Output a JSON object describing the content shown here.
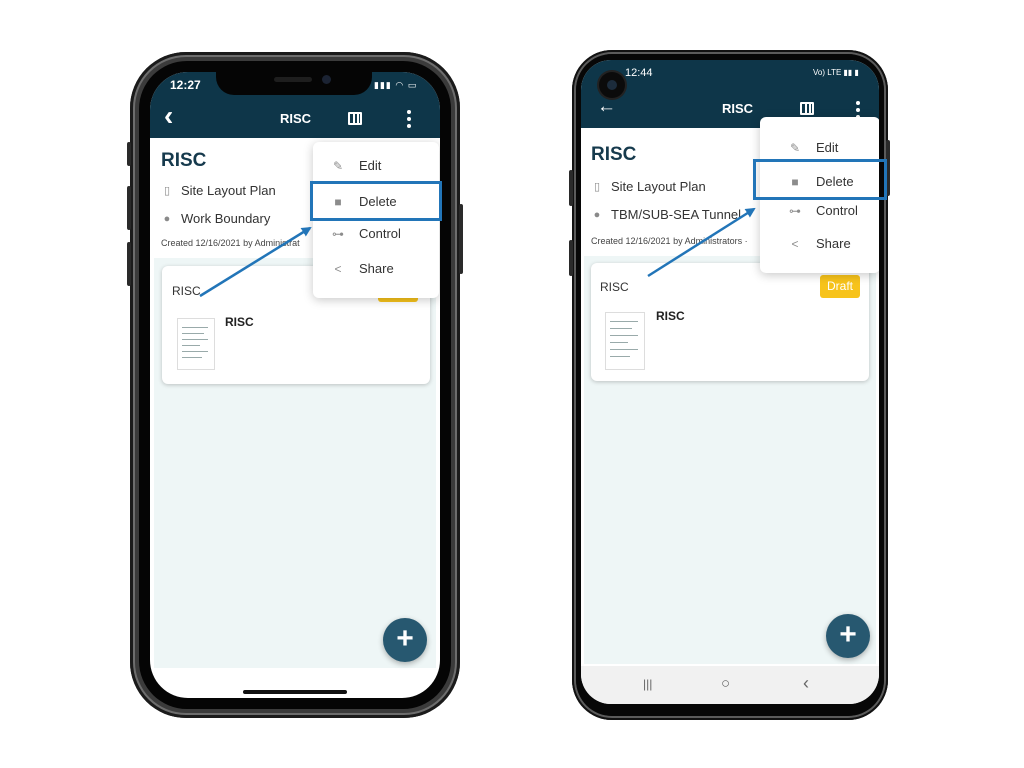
{
  "iphone": {
    "status_time": "12:27",
    "status_icons": "▮▮▮ ◠ ▭",
    "header": {
      "back_glyph": "‹",
      "title": "RISC"
    },
    "doc": {
      "title": "RISC",
      "plan": "Site Layout Plan",
      "location": "Work Boundary",
      "created": "Created 12/16/2021 by Administrat"
    },
    "card": {
      "title": "RISC",
      "doc_name": "RISC"
    },
    "menu": [
      {
        "label": "Edit",
        "icon": "pencil-icon"
      },
      {
        "label": "Delete",
        "icon": "trash-icon"
      },
      {
        "label": "Control",
        "icon": "key-icon"
      },
      {
        "label": "Share",
        "icon": "share-icon"
      }
    ],
    "fab_label": "+"
  },
  "android": {
    "status_time": "12:44",
    "status_icons": "Vo) LTE ▮▮ ▮",
    "header": {
      "back_glyph": "←",
      "title": "RISC"
    },
    "doc": {
      "title": "RISC",
      "plan": "Site Layout Plan",
      "location": "TBM/SUB-SEA Tunnel",
      "created": "Created 12/16/2021 by Administrators ·"
    },
    "card": {
      "title": "RISC",
      "doc_name": "RISC",
      "badge": "Draft"
    },
    "menu": [
      {
        "label": "Edit",
        "icon": "pencil-icon"
      },
      {
        "label": "Delete",
        "icon": "trash-icon"
      },
      {
        "label": "Control",
        "icon": "key-icon"
      },
      {
        "label": "Share",
        "icon": "share-icon"
      }
    ],
    "fab_label": "+",
    "nav": {
      "recents": "|||",
      "home": "○",
      "back": "‹"
    }
  },
  "colors": {
    "header": "#0e3649",
    "highlight": "#2275b8",
    "arrow": "#2275b8",
    "draft": "#f7c31b",
    "fab": "#275870",
    "list_bg": "#eef6f6"
  }
}
